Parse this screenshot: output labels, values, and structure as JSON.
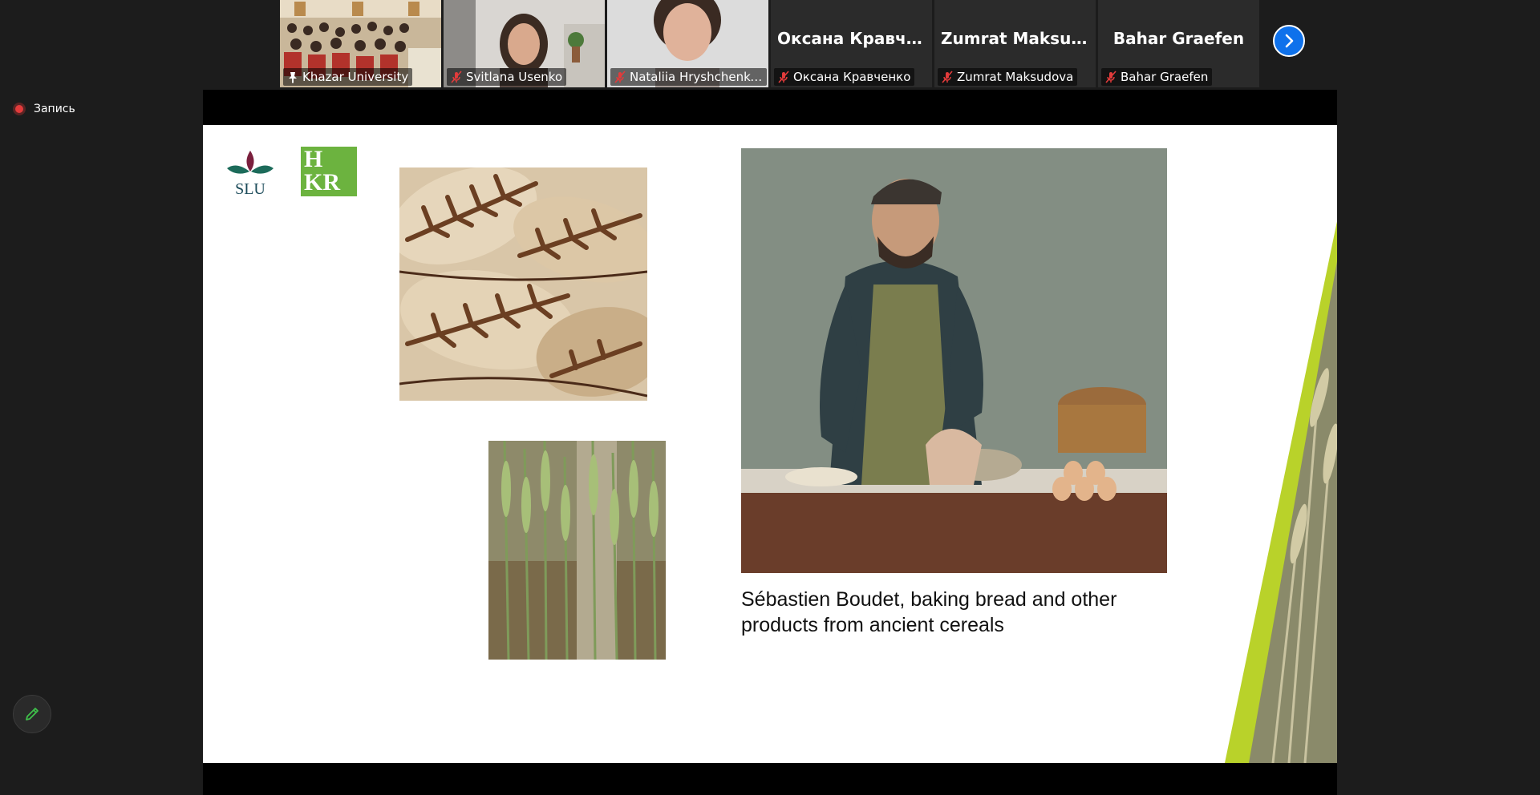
{
  "participants": [
    {
      "name": "Khazar University",
      "big": "",
      "muted": false,
      "pinned": true,
      "active": true
    },
    {
      "name": "Svitlana Usenko",
      "big": "",
      "muted": true
    },
    {
      "name": "Nataliia Hryshchenko, ...",
      "big": "",
      "muted": true
    },
    {
      "name": "Оксана Кравченко",
      "big": "Оксана  Кравче...",
      "muted": true
    },
    {
      "name": "Zumrat Maksudova",
      "big": "Zumrat  Maksud...",
      "muted": true
    },
    {
      "name": "Bahar Graefen",
      "big": "Bahar Graefen",
      "muted": true
    }
  ],
  "record": {
    "label": "Запись",
    "color": "#e23b3b"
  },
  "slide": {
    "caption": "Sébastien Boudet, baking bread and other products from ancient cereals",
    "slu_text": "SLU",
    "hkr_text": [
      "H",
      "KR"
    ]
  },
  "icons": {
    "next": "chevron-right-icon",
    "pen": "pencil-icon",
    "mic_off": "microphone-muted-icon",
    "pin": "pin-icon"
  },
  "colors": {
    "accent": "#0e71eb",
    "active_border": "#c9cf2e",
    "muted_mic": "#e23b3b",
    "hkr_green": "#6cb33f"
  }
}
